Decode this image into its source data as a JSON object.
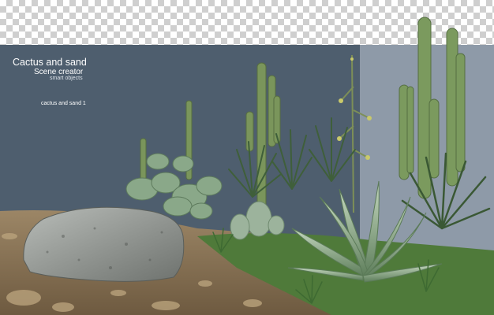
{
  "header": {
    "title": "Cactus and sand",
    "subtitle": "Scene creator",
    "caption": "smart objects"
  },
  "scene": {
    "label": "cactus and sand 1"
  },
  "colors": {
    "wall_dark": "#4e5e6e",
    "wall_light": "#8e9aa8",
    "checker": "#cfcfcf",
    "sand": "#8b7556",
    "cactus_green": "#6f8f5a",
    "agave": "#8fae8a"
  }
}
